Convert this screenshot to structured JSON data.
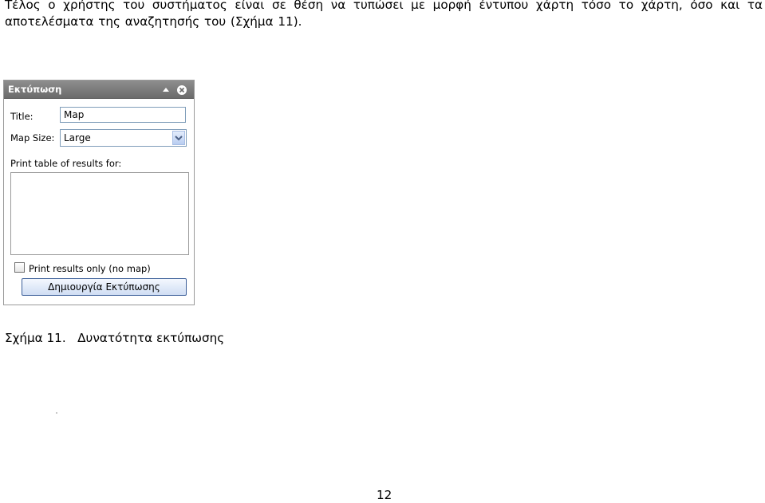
{
  "document": {
    "paragraph": "Τέλος ο χρήστης του συστήματος είναι σε θέση να τυπώσει με μορφή έντυπου χάρτη τόσο το χάρτη, όσο και τα αποτελέσματα της αναζητησής του (Σχήμα 11).",
    "caption_number": "Σχήμα 11.",
    "caption_text": "Δυνατότητα εκτύπωσης",
    "page_number": "12"
  },
  "print_panel": {
    "title": "Εκτύπωση",
    "collapse_icon": "triangle-up-icon",
    "close_icon": "close-circle-icon",
    "title_label": "Title:",
    "title_value": "Map",
    "map_size_label": "Map Size:",
    "map_size_value": "Large",
    "print_table_label": "Print table of results for:",
    "print_results_only_label": "Print results only (no map)",
    "print_results_only_checked": false,
    "create_button_label": "Δημιουργία Εκτύπωσης",
    "colors": {
      "header_bg": "#7a7a7a",
      "input_border": "#7f9db9",
      "button_border": "#3c5f99"
    }
  }
}
